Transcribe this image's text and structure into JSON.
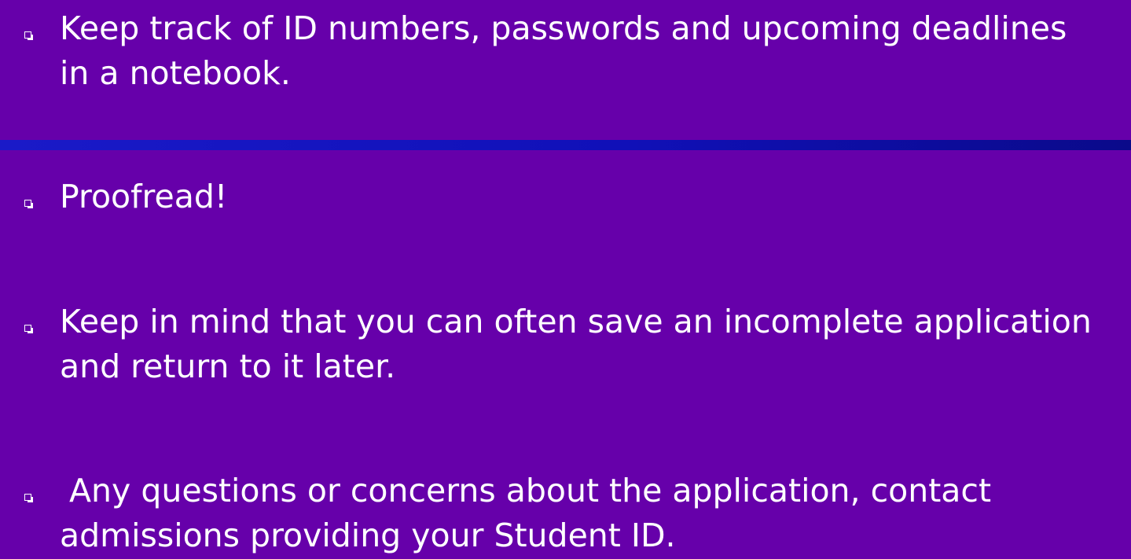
{
  "slide": {
    "background_color": "#6600aa",
    "divider_color": "#1a1ac8",
    "text_color": "#ffffff",
    "bullets": [
      {
        "icon": "hollow-square-bullet-icon",
        "text": "Keep track of ID numbers, passwords and upcoming deadlines in a notebook."
      },
      {
        "icon": "hollow-square-bullet-icon",
        "text": "Proofread!"
      },
      {
        "icon": "hollow-square-bullet-icon",
        "text": "Keep in mind that you can often save an incomplete application and return to it later."
      },
      {
        "icon": "hollow-square-bullet-icon",
        "line1": "Any questions or concerns about the application, contact",
        "line2": "admissions providing your Student ID."
      }
    ]
  }
}
